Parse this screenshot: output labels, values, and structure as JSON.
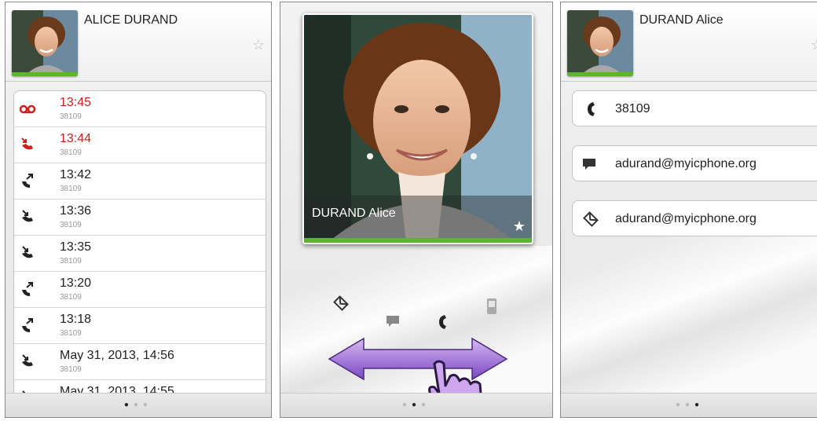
{
  "left": {
    "contact_name": "ALICE DURAND",
    "calls": [
      {
        "time": "13:45",
        "number": "38109",
        "type": "voicemail",
        "missed": true
      },
      {
        "time": "13:44",
        "number": "38109",
        "type": "missed",
        "missed": true
      },
      {
        "time": "13:42",
        "number": "38109",
        "type": "outgoing",
        "missed": false
      },
      {
        "time": "13:36",
        "number": "38109",
        "type": "incoming",
        "missed": false
      },
      {
        "time": "13:35",
        "number": "38109",
        "type": "incoming",
        "missed": false
      },
      {
        "time": "13:20",
        "number": "38109",
        "type": "outgoing",
        "missed": false
      },
      {
        "time": "13:18",
        "number": "38109",
        "type": "outgoing",
        "missed": false
      },
      {
        "time": "May 31, 2013, 14:56",
        "number": "38109",
        "type": "incoming",
        "missed": false
      },
      {
        "time": "May 31, 2013, 14:55",
        "number": "",
        "type": "incoming",
        "missed": false
      }
    ],
    "page_indicator": {
      "count": 3,
      "active": 0
    }
  },
  "center": {
    "card_name": "DURAND Alice",
    "page_indicator": {
      "count": 3,
      "active": 1
    },
    "quick_actions": [
      "email-icon",
      "im-icon",
      "phone-icon",
      "mobile-icon"
    ]
  },
  "right": {
    "contact_name": "DURAND Alice",
    "details": [
      {
        "icon": "phone-icon",
        "value": "38109"
      },
      {
        "icon": "im-icon",
        "value": "adurand@myicphone.org"
      },
      {
        "icon": "email-icon",
        "value": "adurand@myicphone.org"
      }
    ],
    "page_indicator": {
      "count": 3,
      "active": 2
    }
  },
  "colors": {
    "presence": "#5ab52f",
    "missed": "#cc1f1f",
    "swipe_arrow": "#8e5bd1"
  }
}
